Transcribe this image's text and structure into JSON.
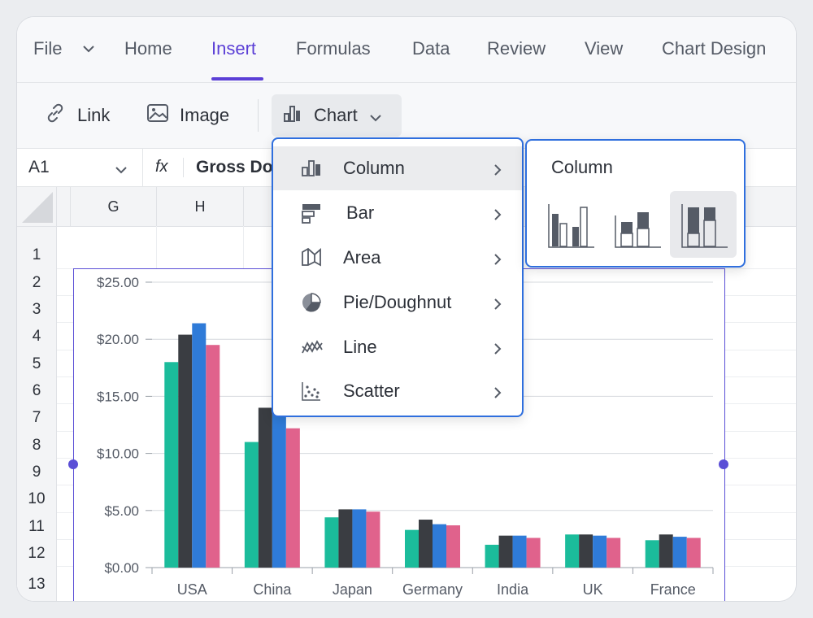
{
  "menu": {
    "items": [
      "File",
      "Home",
      "Insert",
      "Formulas",
      "Data",
      "Review",
      "View",
      "Chart Design"
    ],
    "active": "Insert"
  },
  "toolbar": {
    "link_label": "Link",
    "image_label": "Image",
    "chart_label": "Chart"
  },
  "formula_bar": {
    "cell_ref": "A1",
    "fx_label": "fx",
    "value": "Gross Do"
  },
  "grid": {
    "columns": [
      "G",
      "H"
    ],
    "rows": [
      "1",
      "2",
      "3",
      "4",
      "5",
      "6",
      "7",
      "8",
      "9",
      "10",
      "11",
      "12",
      "13"
    ]
  },
  "chart_menu": {
    "items": [
      "Column",
      "Bar",
      "Area",
      "Pie/Doughnut",
      "Line",
      "Scatter"
    ],
    "highlighted": "Column"
  },
  "submenu": {
    "title": "Column",
    "options": [
      "clustered-column",
      "stacked-column",
      "100%-stacked-column"
    ],
    "selected": "100%-stacked-column"
  },
  "colors": {
    "accent": "#5b3fd6",
    "menu_border": "#2f6fde",
    "series": [
      "#1bbc9b",
      "#3a3d42",
      "#2f7bd8",
      "#e0628c"
    ]
  },
  "chart_data": {
    "type": "bar",
    "categories": [
      "USA",
      "China",
      "Japan",
      "Germany",
      "India",
      "UK",
      "France"
    ],
    "series": [
      {
        "values": [
          18.0,
          11.0,
          4.4,
          3.3,
          2.0,
          2.9,
          2.4
        ]
      },
      {
        "values": [
          20.4,
          14.0,
          5.1,
          4.2,
          2.8,
          2.9,
          2.9
        ]
      },
      {
        "values": [
          21.4,
          14.0,
          5.1,
          3.8,
          2.8,
          2.8,
          2.7
        ]
      },
      {
        "values": [
          19.5,
          12.2,
          4.9,
          3.7,
          2.6,
          2.6,
          2.6
        ]
      }
    ],
    "yticks": [
      "$0.00",
      "$5.00",
      "$10.00",
      "$15.00",
      "$20.00",
      "$25.00"
    ],
    "ylim": [
      0,
      25
    ],
    "grid": true
  }
}
